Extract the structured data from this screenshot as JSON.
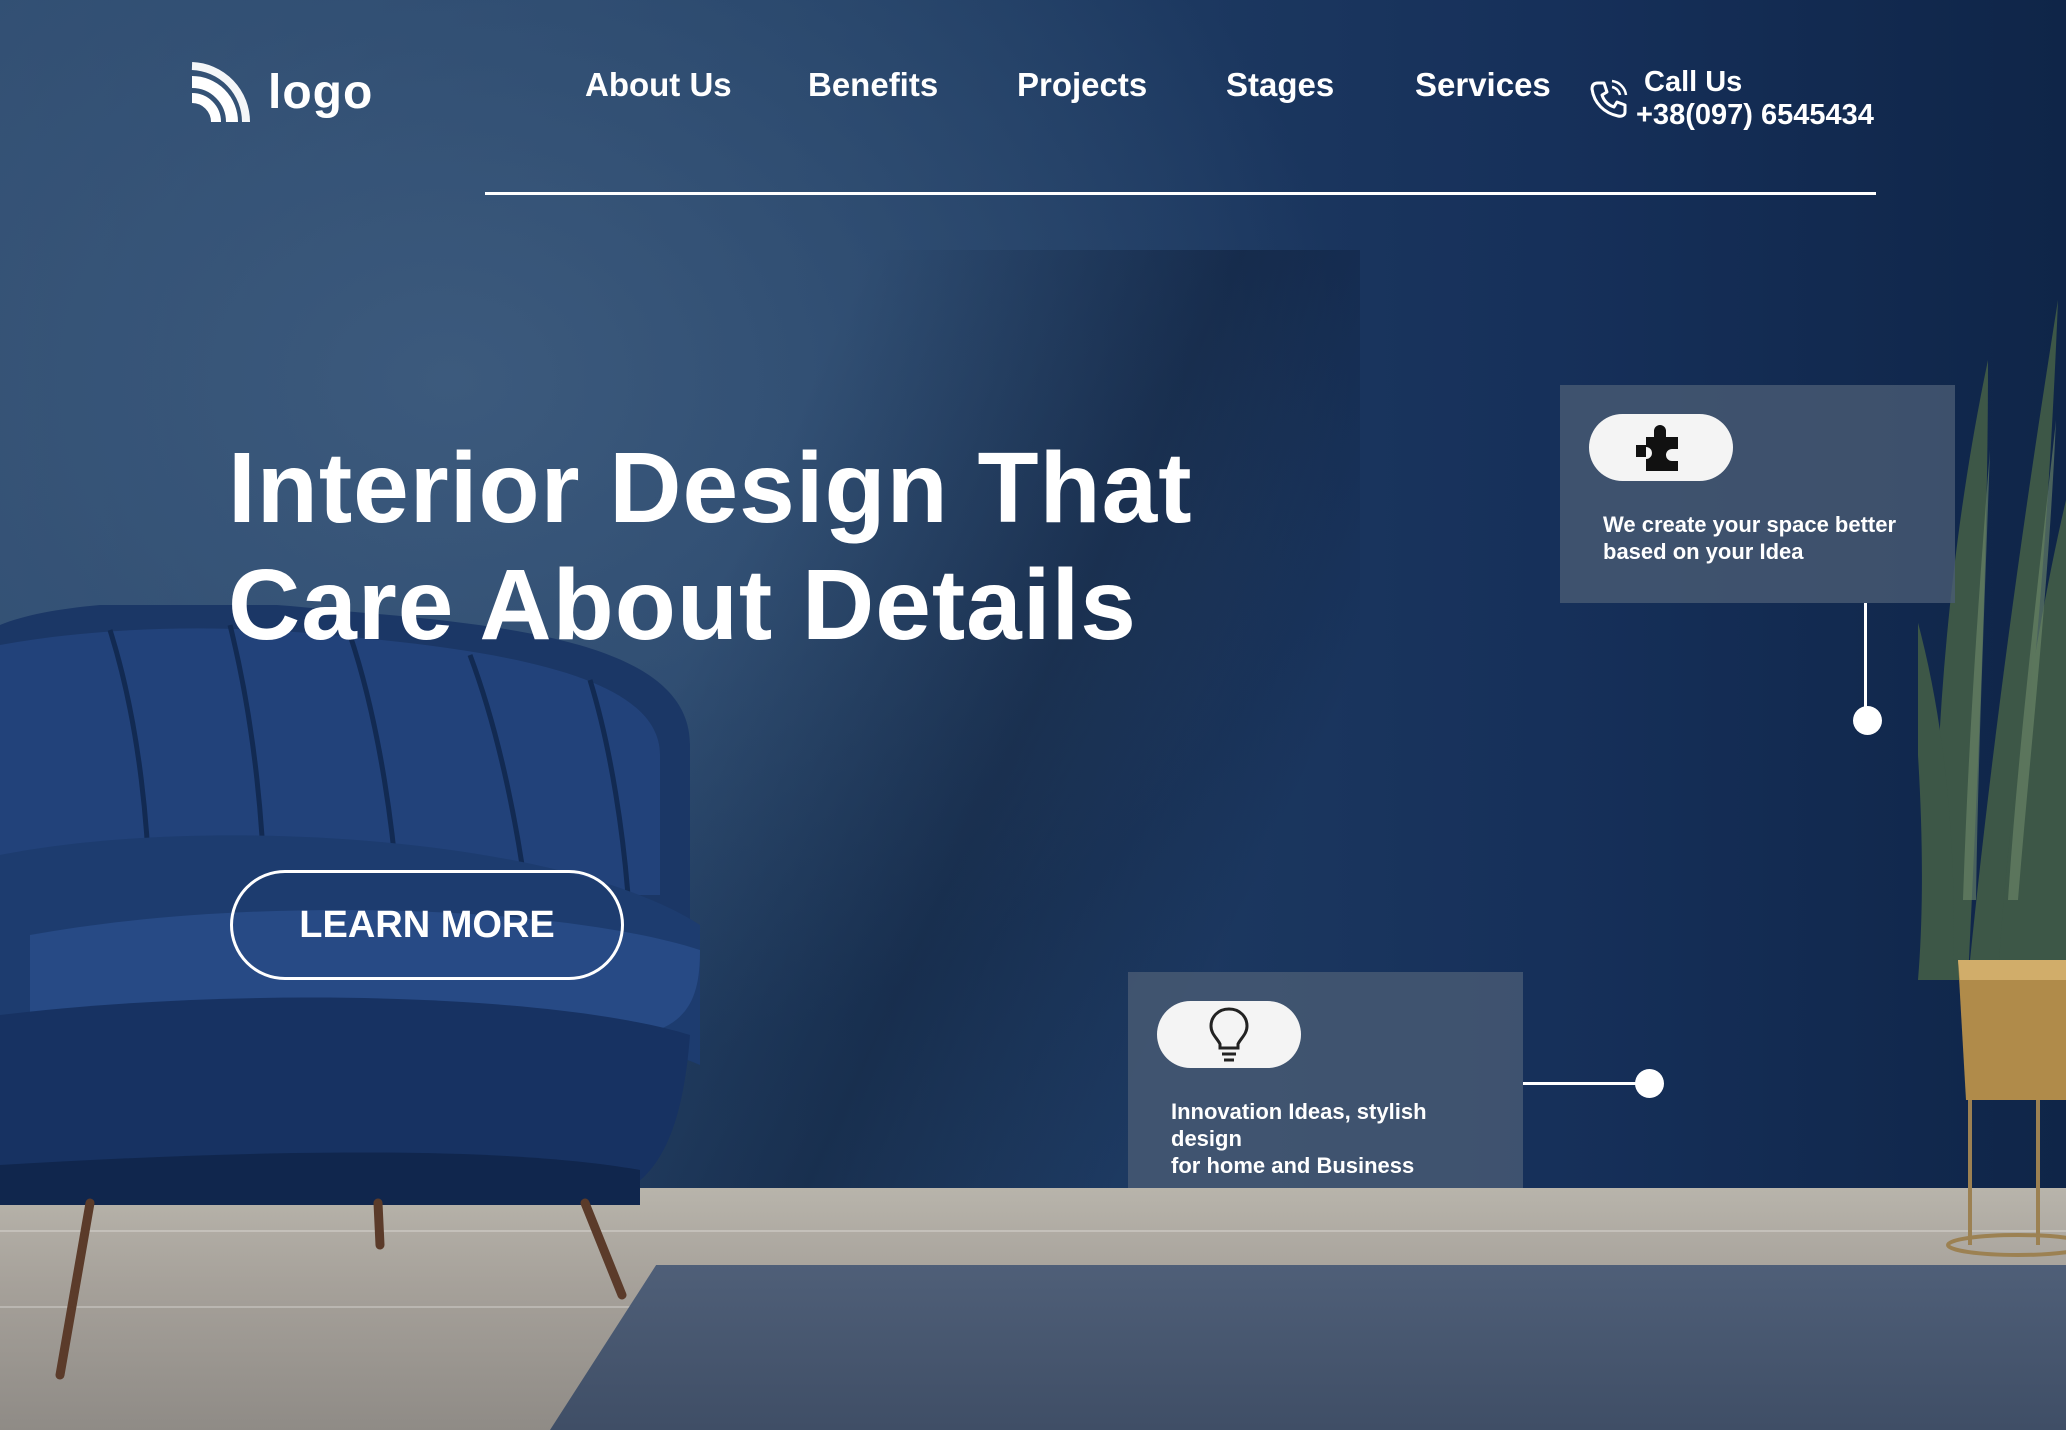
{
  "brand": {
    "logo_text": "logo"
  },
  "nav": {
    "items": [
      {
        "label": "About Us"
      },
      {
        "label": "Benefits"
      },
      {
        "label": "Projects"
      },
      {
        "label": "Stages"
      },
      {
        "label": "Services"
      }
    ]
  },
  "contact": {
    "label": "Call Us",
    "phone": "+38(097) 6545434",
    "icon": "phone-icon"
  },
  "hero": {
    "title_line1": "Interior Design That",
    "title_line2": "Care About Details",
    "cta_label": "LEARN MORE"
  },
  "features": [
    {
      "icon": "puzzle-icon",
      "line1": "We create your space better",
      "line2": "based on your Idea"
    },
    {
      "icon": "lightbulb-icon",
      "line1": "Innovation Ideas, stylish",
      "line2": "design",
      "line3": "for home and Business"
    }
  ],
  "colors": {
    "background": "#1f3a60",
    "card": "#4a5c74",
    "text": "#ffffff"
  }
}
